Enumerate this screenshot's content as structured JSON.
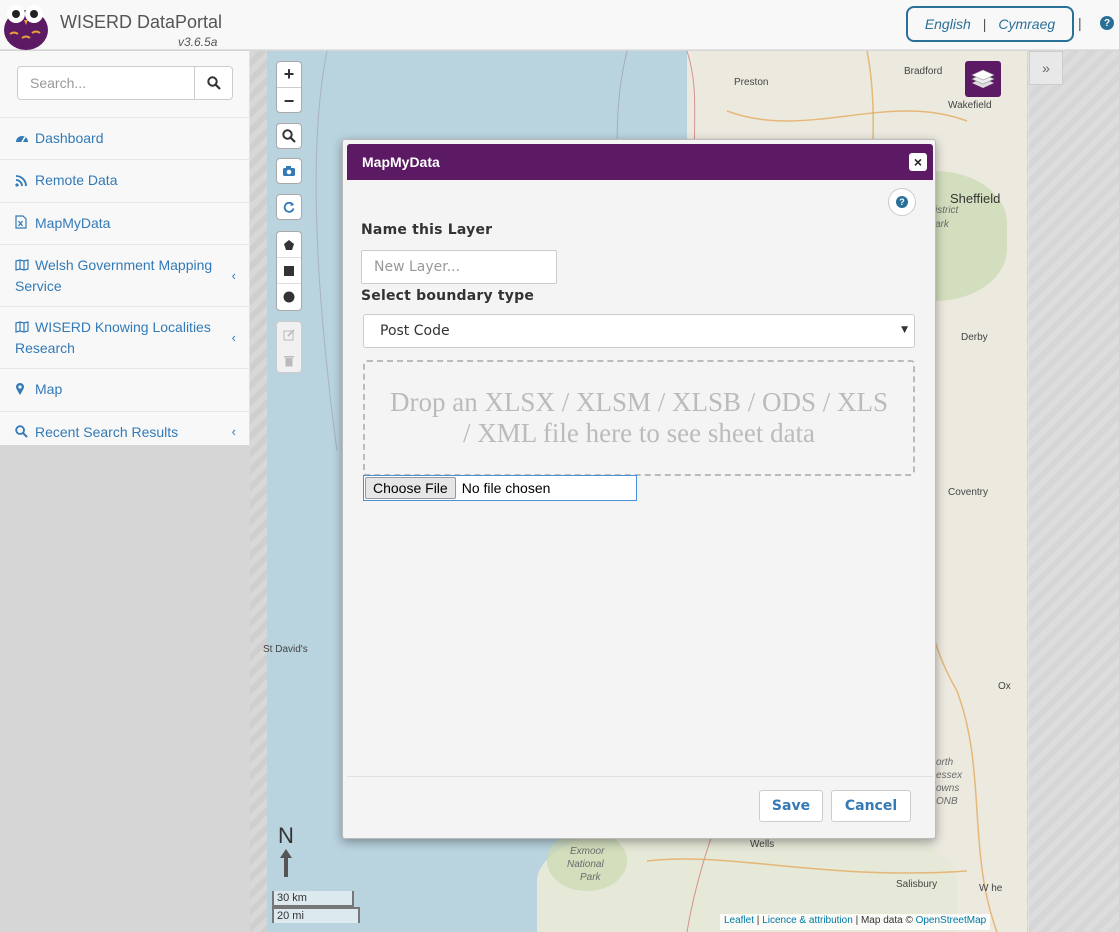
{
  "header": {
    "brand": "WISERD DataPortal",
    "version": "v3.6.5a",
    "lang_english": "English",
    "lang_sep": "|",
    "lang_welsh": "Cymraeg",
    "separator": "|"
  },
  "sidebar": {
    "search_placeholder": "Search...",
    "items": [
      {
        "label": "Dashboard",
        "icon": "dashboard-icon",
        "has_chevron": false
      },
      {
        "label": "Remote Data",
        "icon": "rss-icon",
        "has_chevron": false
      },
      {
        "label": "MapMyData",
        "icon": "excel-file-icon",
        "has_chevron": false
      },
      {
        "label": "Welsh Government Mapping Service",
        "icon": "map-icon",
        "has_chevron": true
      },
      {
        "label": "WISERD Knowing Localities Research",
        "icon": "map-icon",
        "has_chevron": true
      },
      {
        "label": "Map",
        "icon": "map-marker-icon",
        "has_chevron": false
      },
      {
        "label": "Recent Search Results",
        "icon": "search-icon",
        "has_chevron": true
      }
    ]
  },
  "map": {
    "zoom_in": "+",
    "zoom_out": "−",
    "north": "N",
    "scale_km": "30 km",
    "scale_mi": "20 mi",
    "attribution": {
      "leaflet": "Leaflet",
      "sep1": " | ",
      "licence": "Licence & attribution",
      "sep2": " | Map data © ",
      "osm": "OpenStreetMap"
    },
    "places": {
      "bradford": "Bradford",
      "preston": "Preston",
      "wakefield": "Wakefield",
      "sheffield": "Sheffield",
      "district": "istrict",
      "park": "ark",
      "derby": "Derby",
      "coventry": "Coventry",
      "st_davids": "St David's",
      "ox": "Ox",
      "north_wessex_1": "orth",
      "north_wessex_2": "essex",
      "north_wessex_3": "owns",
      "north_wessex_4": "ONB",
      "wells": "Wells",
      "exmoor_1": "Exmoor",
      "exmoor_2": "National",
      "exmoor_3": "Park",
      "salisbury": "Salisbury",
      "wh": "W  he"
    }
  },
  "modal": {
    "title": "MapMyData",
    "close": "×",
    "help": "?",
    "name_label": "Name this Layer",
    "name_placeholder": "New Layer...",
    "boundary_label": "Select boundary type",
    "boundary_value": "Post Code",
    "dropzone_text": "Drop an XLSX / XLSM / XLSB / ODS / XLS / XML file here to see sheet data",
    "file_button": "Choose File",
    "file_status": "No file chosen",
    "save": "Save",
    "cancel": "Cancel"
  },
  "right_panel": {
    "expand": "»"
  },
  "colors": {
    "brand_purple": "#5b1a63",
    "link_blue": "#337ab7",
    "lang_blue": "#2a6f97"
  }
}
